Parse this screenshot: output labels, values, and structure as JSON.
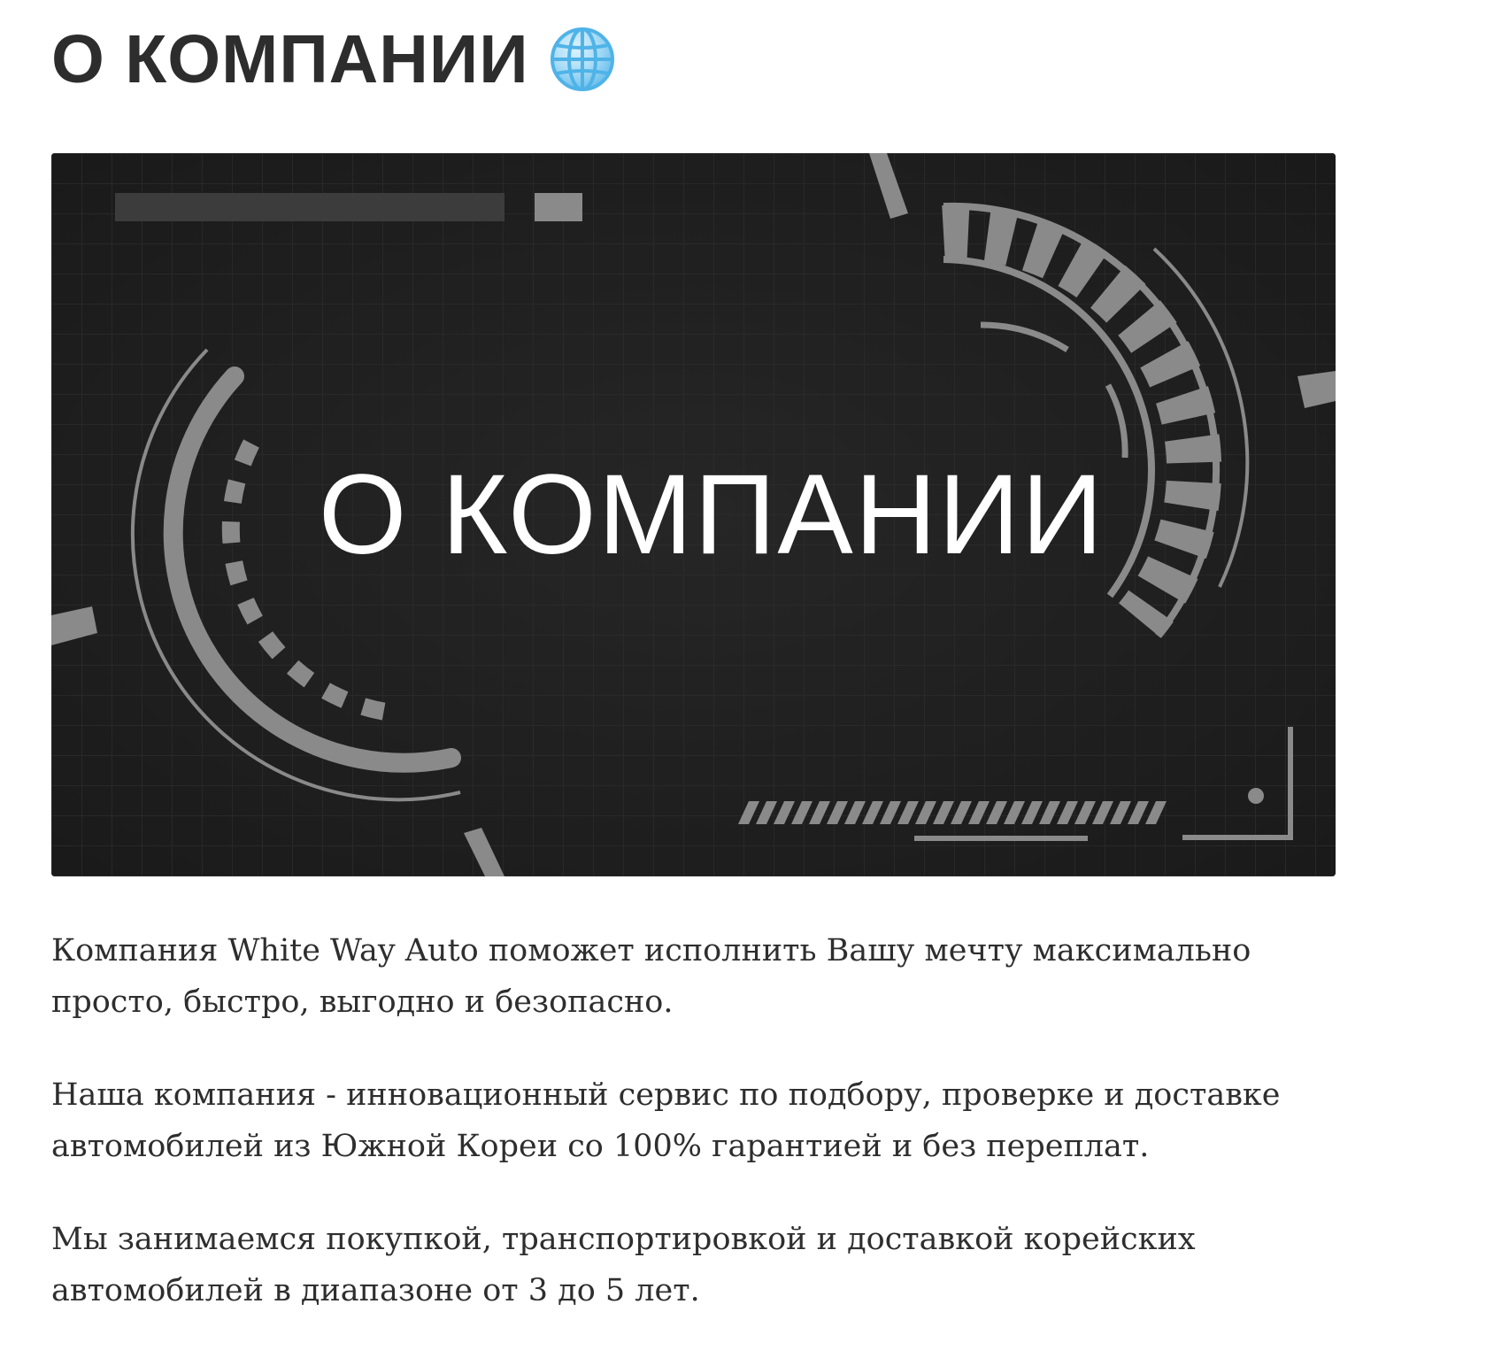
{
  "header": {
    "title": "О КОМПАНИИ",
    "icon": "globe-icon"
  },
  "banner": {
    "title": "О КОМПАНИИ"
  },
  "content": {
    "paragraphs": [
      "Компания White Way Auto поможет исполнить Вашу мечту максимально просто, быстро, выгодно и безопасно.",
      "Наша компания - инновационный сервис по подбору, проверке и доставке автомобилей из Южной Кореи со 100% гарантией и без переплат.",
      "Мы занимаемся покупкой, транспортировкой и доставкой корейских автомобилей в диапазоне от 3 до 5 лет."
    ]
  },
  "colors": {
    "banner_bg": "#202020",
    "banner_shape": "#8a8a8a",
    "title_text": "#2d2d2d",
    "globe_blue": "#4fb3e8"
  }
}
